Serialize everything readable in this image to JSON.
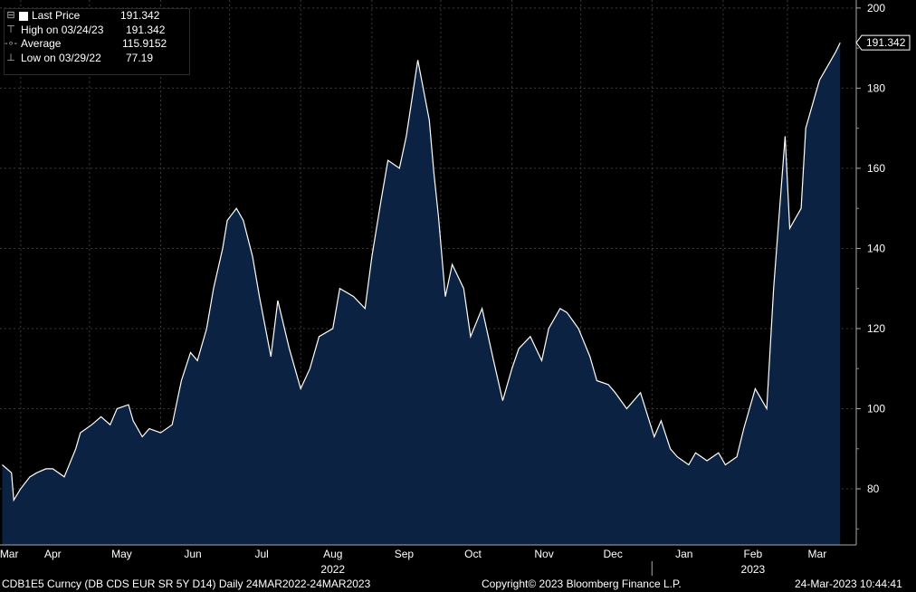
{
  "legend": {
    "last_price_label": "Last Price",
    "last_price_value": "191.342",
    "high_label": "High on 03/24/23",
    "high_value": "191.342",
    "average_label": "Average",
    "average_value": "115.9152",
    "low_label": "Low on 03/29/22",
    "low_value": "77.19"
  },
  "last_price_tag": "191.342",
  "footer": {
    "security": "CDB1E5 Curncy (DB CDS EUR SR 5Y D14)  Daily 24MAR2022-24MAR2023",
    "copyright": "Copyright© 2023 Bloomberg Finance L.P.",
    "timestamp": "24-Mar-2023 10:44:41"
  },
  "colors": {
    "background": "#000000",
    "area_fill": "#0b2242",
    "line": "#ffffff",
    "grid": "#3a3a3a"
  },
  "chart_data": {
    "type": "area",
    "x": [
      "2022-03-24",
      "2022-03-28",
      "2022-03-29",
      "2022-04-01",
      "2022-04-05",
      "2022-04-08",
      "2022-04-12",
      "2022-04-15",
      "2022-04-20",
      "2022-04-25",
      "2022-04-27",
      "2022-05-02",
      "2022-05-06",
      "2022-05-10",
      "2022-05-13",
      "2022-05-18",
      "2022-05-20",
      "2022-05-24",
      "2022-05-27",
      "2022-06-01",
      "2022-06-06",
      "2022-06-10",
      "2022-06-14",
      "2022-06-17",
      "2022-06-21",
      "2022-06-24",
      "2022-06-28",
      "2022-06-30",
      "2022-07-04",
      "2022-07-07",
      "2022-07-11",
      "2022-07-14",
      "2022-07-19",
      "2022-07-22",
      "2022-07-27",
      "2022-08-01",
      "2022-08-05",
      "2022-08-09",
      "2022-08-15",
      "2022-08-18",
      "2022-08-24",
      "2022-08-29",
      "2022-09-01",
      "2022-09-05",
      "2022-09-08",
      "2022-09-13",
      "2022-09-16",
      "2022-09-21",
      "2022-09-26",
      "2022-09-28",
      "2022-09-30",
      "2022-10-03",
      "2022-10-06",
      "2022-10-11",
      "2022-10-14",
      "2022-10-19",
      "2022-10-24",
      "2022-10-28",
      "2022-11-01",
      "2022-11-04",
      "2022-11-09",
      "2022-11-14",
      "2022-11-17",
      "2022-11-22",
      "2022-11-25",
      "2022-11-30",
      "2022-12-05",
      "2022-12-08",
      "2022-12-13",
      "2022-12-16",
      "2022-12-21",
      "2022-12-27",
      "2023-01-02",
      "2023-01-05",
      "2023-01-09",
      "2023-01-12",
      "2023-01-17",
      "2023-01-20",
      "2023-01-25",
      "2023-01-30",
      "2023-02-02",
      "2023-02-07",
      "2023-02-10",
      "2023-02-15",
      "2023-02-20",
      "2023-02-23",
      "2023-02-28",
      "2023-03-02",
      "2023-03-07",
      "2023-03-09",
      "2023-03-13",
      "2023-03-15",
      "2023-03-17",
      "2023-03-20",
      "2023-03-22",
      "2023-03-24"
    ],
    "series": [
      {
        "values": [
          86,
          84,
          77.19,
          80,
          83,
          84,
          85,
          85,
          83,
          90,
          94,
          96,
          98,
          96,
          100,
          101,
          97,
          93,
          95,
          94,
          96,
          107,
          114,
          112,
          120,
          130,
          140,
          147,
          150,
          147,
          138,
          128,
          113,
          127,
          115,
          105,
          110,
          118,
          120,
          130,
          128,
          125,
          138,
          152,
          162,
          160,
          168,
          187,
          172,
          159,
          148,
          128,
          136,
          130,
          118,
          125,
          112,
          102,
          110,
          115,
          118,
          112,
          120,
          125,
          124,
          120,
          113,
          107,
          106,
          104,
          100,
          104,
          93,
          97,
          90,
          88,
          86,
          89,
          87,
          89,
          86,
          88,
          95,
          105,
          100,
          130,
          168,
          145,
          150,
          170,
          178,
          182,
          184,
          187,
          189,
          191.342
        ]
      }
    ],
    "ylim": [
      66,
      202
    ],
    "y_ticks": [
      80,
      100,
      120,
      140,
      160,
      180,
      200
    ],
    "x_tick_labels": [
      "Mar",
      "Apr",
      "May",
      "Jun",
      "Jul",
      "Aug",
      "Sep",
      "Oct",
      "Nov",
      "Dec",
      "Jan",
      "Feb",
      "Mar"
    ],
    "year_labels": [
      "2022",
      "2023"
    ],
    "grid": true,
    "legend_placement": "top-left"
  }
}
